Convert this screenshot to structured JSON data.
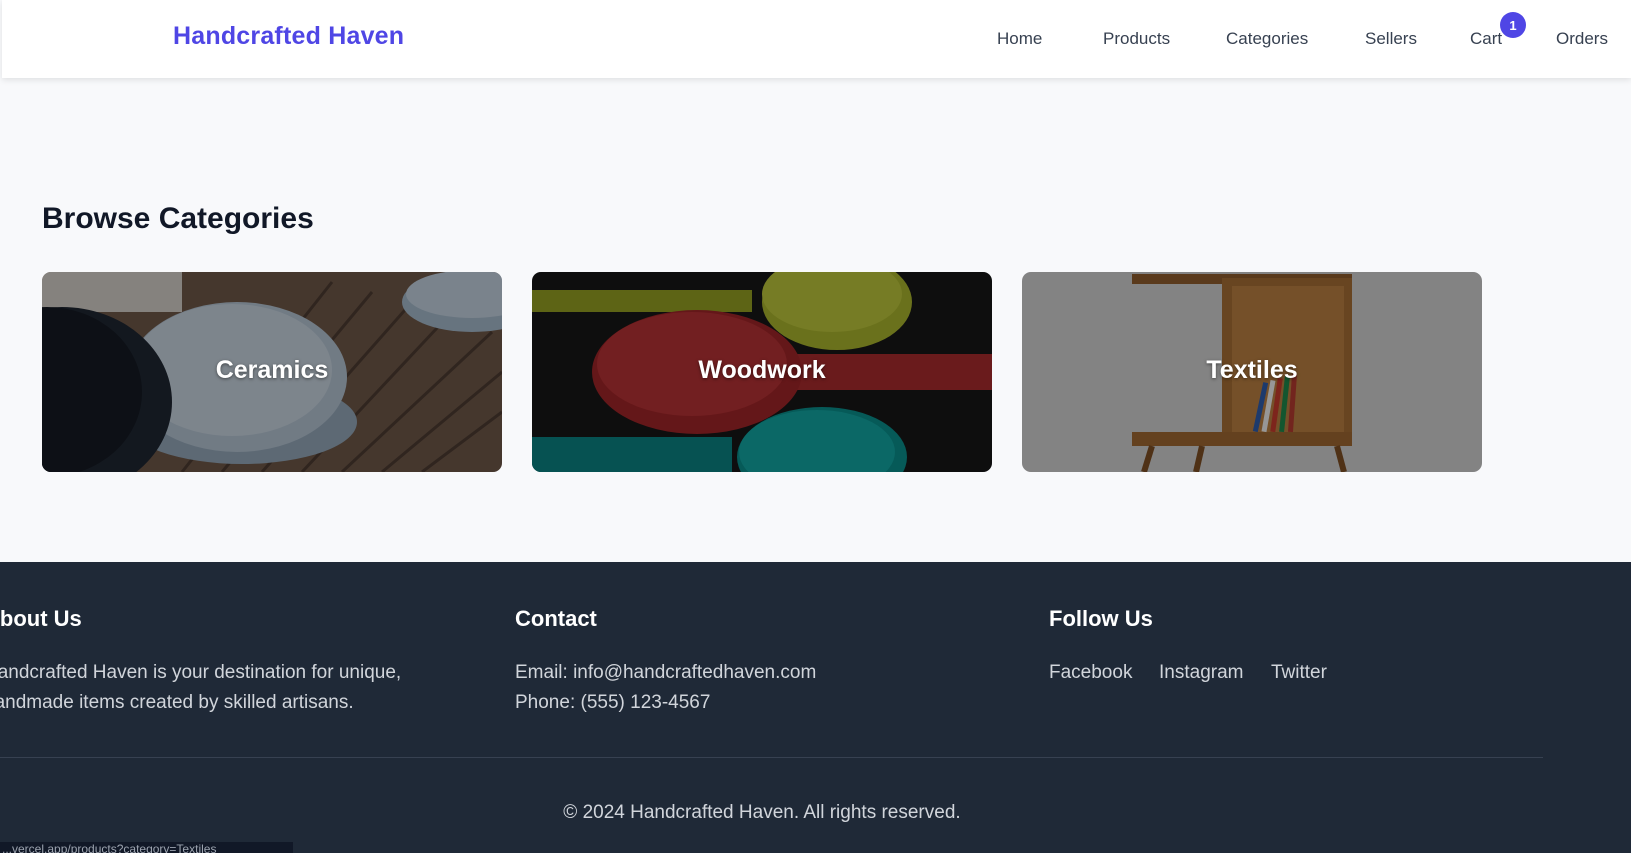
{
  "header": {
    "brand": "Handcrafted Haven",
    "nav": [
      {
        "label": "Home"
      },
      {
        "label": "Products"
      },
      {
        "label": "Categories"
      },
      {
        "label": "Sellers"
      },
      {
        "label": "Cart"
      },
      {
        "label": "Orders"
      }
    ],
    "cart_count": "1"
  },
  "main": {
    "title": "Browse Categories",
    "categories": [
      {
        "name": "Ceramics"
      },
      {
        "name": "Woodwork"
      },
      {
        "name": "Textiles"
      }
    ]
  },
  "footer": {
    "about": {
      "heading": "About Us",
      "text_line1": "Handcrafted Haven is your destination for unique,",
      "text_line2": "handmade items created by skilled artisans."
    },
    "contact": {
      "heading": "Contact",
      "email": "Email: info@handcraftedhaven.com",
      "phone": "Phone: (555) 123-4567"
    },
    "follow": {
      "heading": "Follow Us",
      "links": [
        "Facebook",
        "Instagram",
        "Twitter"
      ]
    },
    "copyright": "© 2024 Handcrafted Haven. All rights reserved."
  },
  "status_bar": {
    "url": "...vercel.app/products?category=Textiles"
  },
  "colors": {
    "brand": "#4f46e5",
    "footer_bg": "#1f2937",
    "page_bg": "#f8f9fb"
  }
}
